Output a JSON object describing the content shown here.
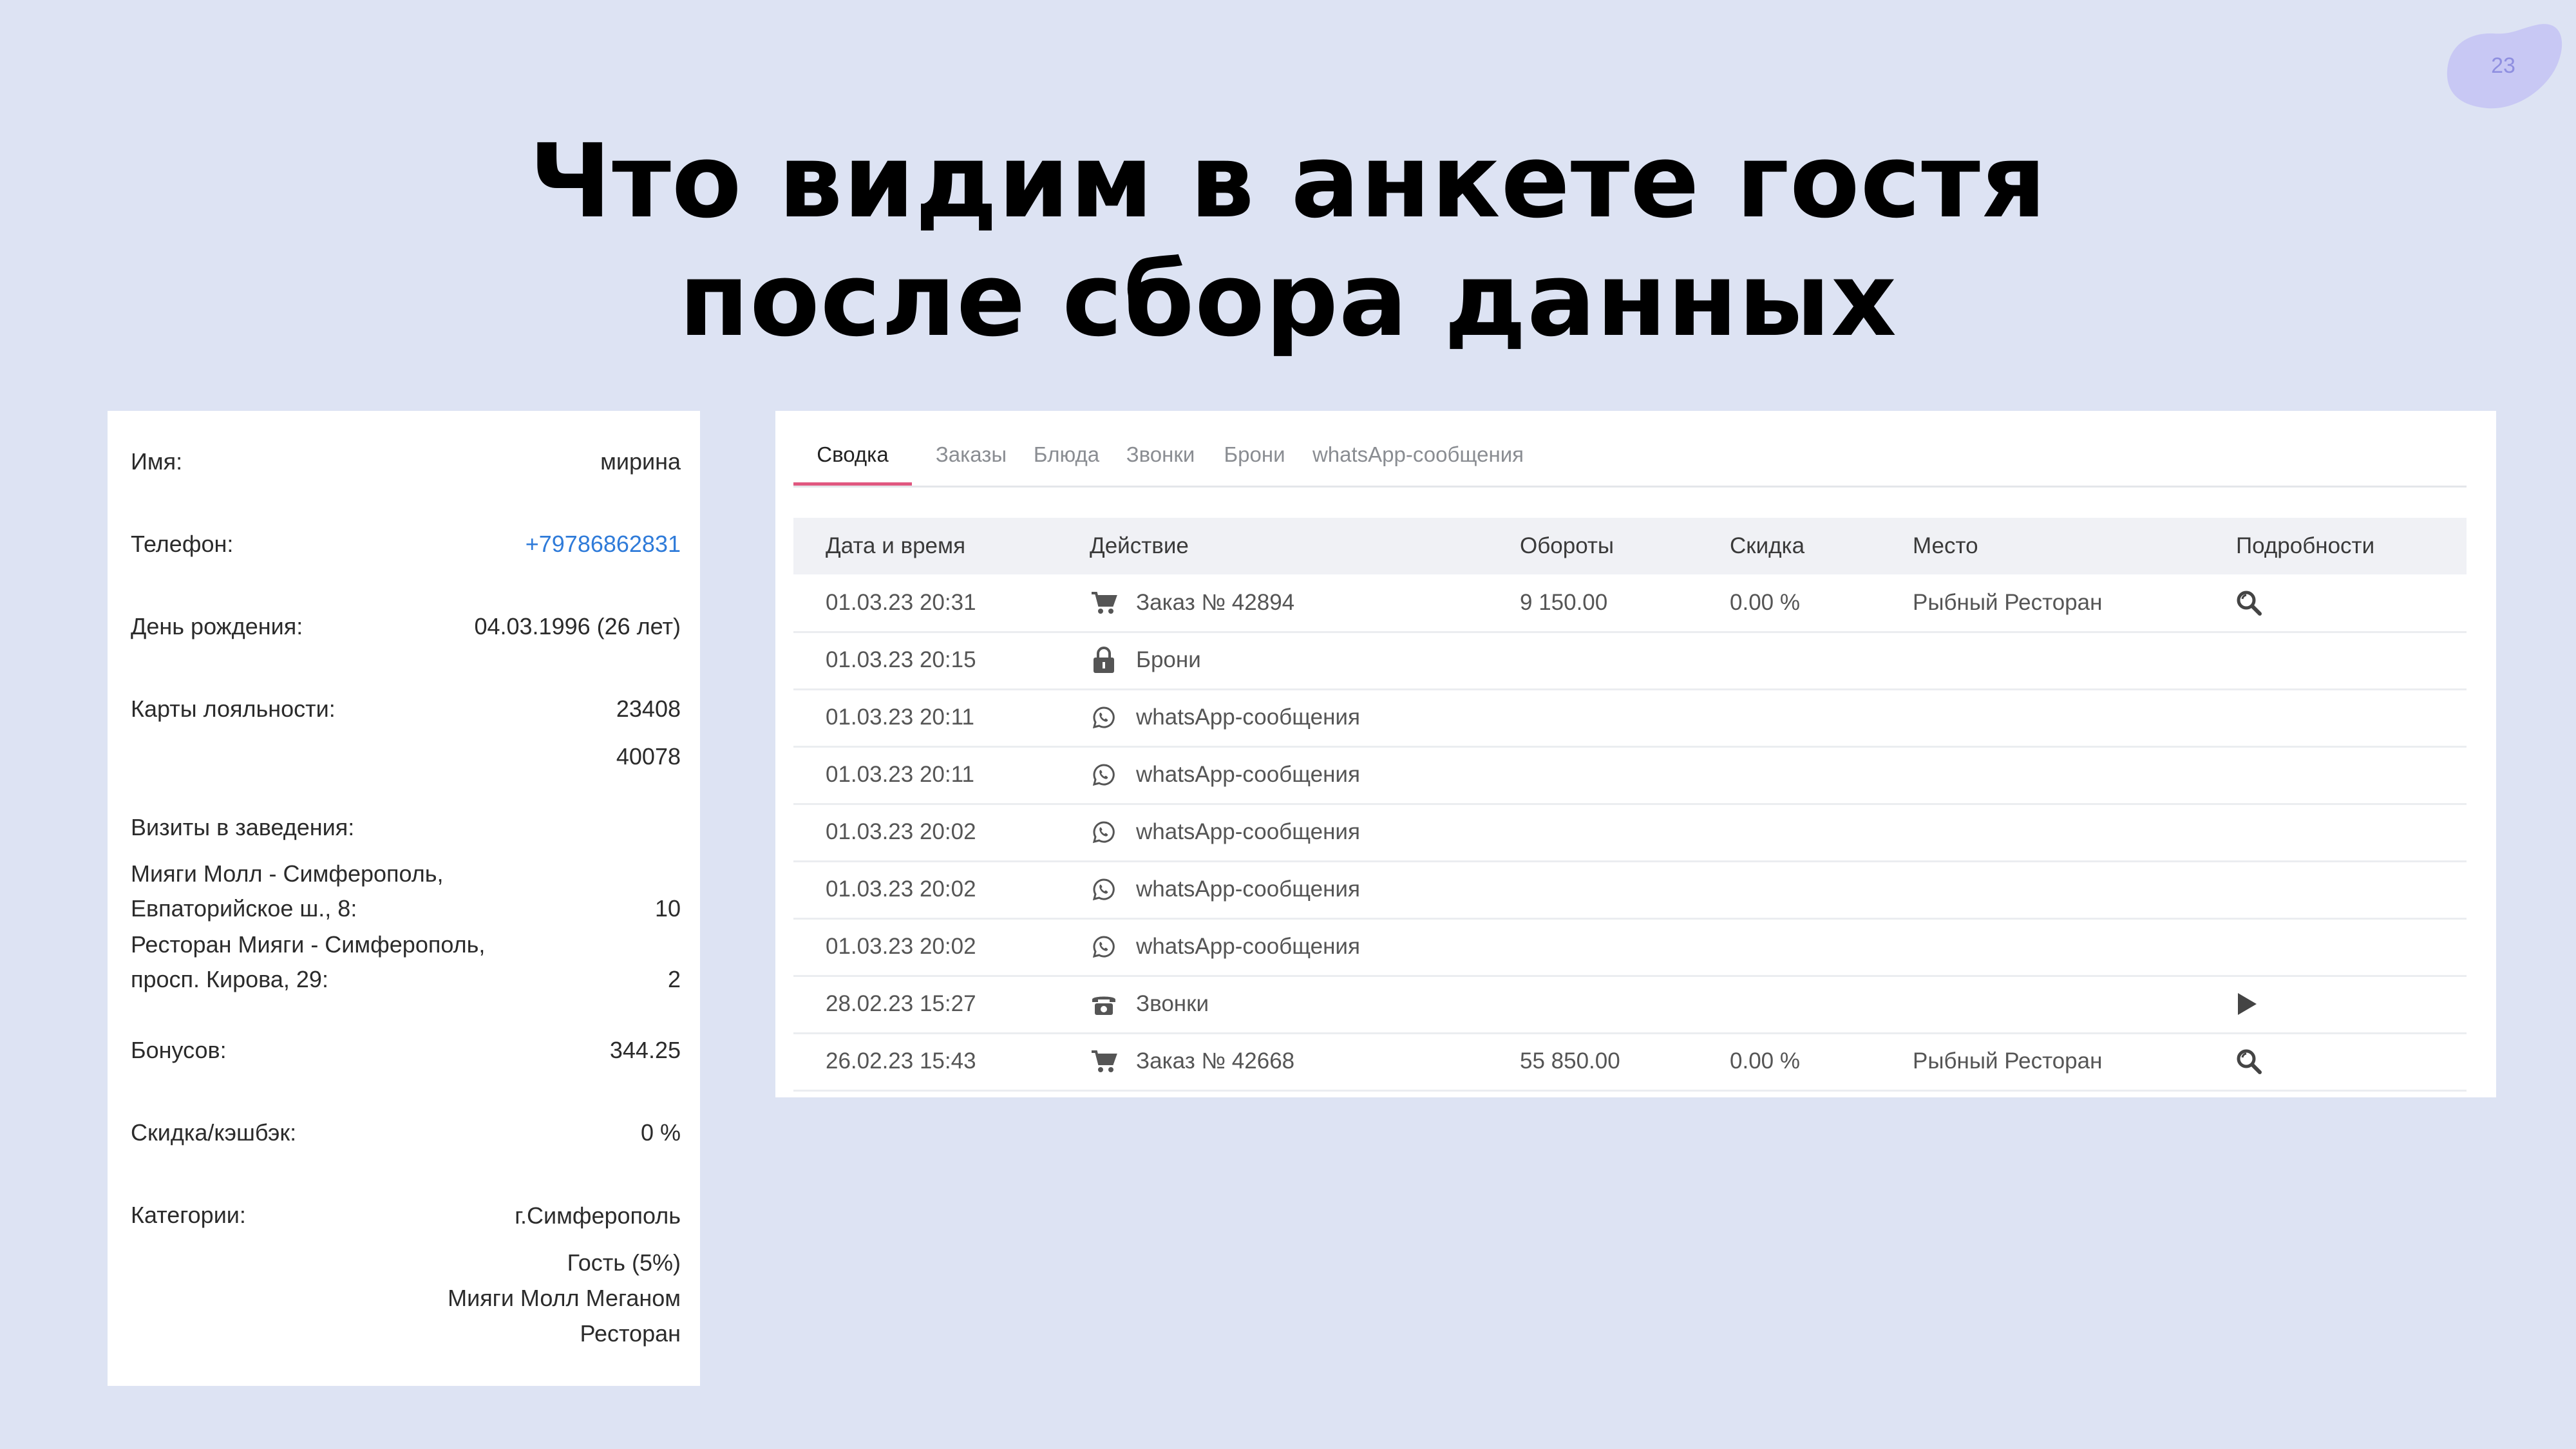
{
  "slide": {
    "page_number": "23",
    "title_line1": "Что видим в анкете гостя",
    "title_line2": "после сбора данных"
  },
  "guest": {
    "name_label": "Имя:",
    "name_value": "мирина",
    "phone_label": "Телефон:",
    "phone_value": "+79786862831",
    "birthday_label": "День рождения:",
    "birthday_value": "04.03.1996 (26 лет)",
    "cards_label": "Карты лояльности:",
    "cards": [
      "23408",
      "40078"
    ],
    "visits_label": "Визиты в заведения:",
    "visits": [
      {
        "line1": "Мияги Молл - Симферополь,",
        "line2": "Евпаторийское ш., 8:",
        "count": "10"
      },
      {
        "line1": "Ресторан Мияги - Симферополь,",
        "line2": "просп. Кирова, 29:",
        "count": "2"
      }
    ],
    "bonus_label": "Бонусов:",
    "bonus_value": "344.25",
    "discount_label": "Скидка/кэшбэк:",
    "discount_value": "0 %",
    "categories_label": "Категории:",
    "categories": [
      "г.Симферополь",
      "Гость (5%)",
      "Мияги Молл Меганом",
      "Ресторан"
    ]
  },
  "tabs": [
    "Сводка",
    "Заказы",
    "Блюда",
    "Звонки",
    "Брони",
    "whatsApp-сообщения"
  ],
  "table": {
    "headers": [
      "Дата и время",
      "Действие",
      "Обороты",
      "Скидка",
      "Место",
      "Подробности"
    ],
    "rows": [
      {
        "date": "01.03.23 20:31",
        "icon": "cart-icon",
        "action": "Заказ № 42894",
        "turnover": "9 150.00",
        "discount": "0.00 %",
        "place": "Рыбный Ресторан",
        "details": "search-icon"
      },
      {
        "date": "01.03.23 20:15",
        "icon": "lock-icon",
        "action": "Брони",
        "turnover": "",
        "discount": "",
        "place": "",
        "details": ""
      },
      {
        "date": "01.03.23 20:11",
        "icon": "whatsapp-icon",
        "action": "whatsApp-сообщения",
        "turnover": "",
        "discount": "",
        "place": "",
        "details": ""
      },
      {
        "date": "01.03.23 20:11",
        "icon": "whatsapp-icon",
        "action": "whatsApp-сообщения",
        "turnover": "",
        "discount": "",
        "place": "",
        "details": ""
      },
      {
        "date": "01.03.23 20:02",
        "icon": "whatsapp-icon",
        "action": "whatsApp-сообщения",
        "turnover": "",
        "discount": "",
        "place": "",
        "details": ""
      },
      {
        "date": "01.03.23 20:02",
        "icon": "whatsapp-icon",
        "action": "whatsApp-сообщения",
        "turnover": "",
        "discount": "",
        "place": "",
        "details": ""
      },
      {
        "date": "01.03.23 20:02",
        "icon": "whatsapp-icon",
        "action": "whatsApp-сообщения",
        "turnover": "",
        "discount": "",
        "place": "",
        "details": ""
      },
      {
        "date": "28.02.23 15:27",
        "icon": "phone-icon",
        "action": "Звонки",
        "turnover": "",
        "discount": "",
        "place": "",
        "details": "play-icon"
      },
      {
        "date": "26.02.23 15:43",
        "icon": "cart-icon",
        "action": "Заказ № 42668",
        "turnover": "55 850.00",
        "discount": "0.00 %",
        "place": "Рыбный Ресторан",
        "details": "search-icon"
      }
    ]
  },
  "colors": {
    "background": "#dde3f3",
    "accent_tab": "#e0577f",
    "phone_link": "#2f7bd9",
    "blob": "#c8c8f4"
  }
}
